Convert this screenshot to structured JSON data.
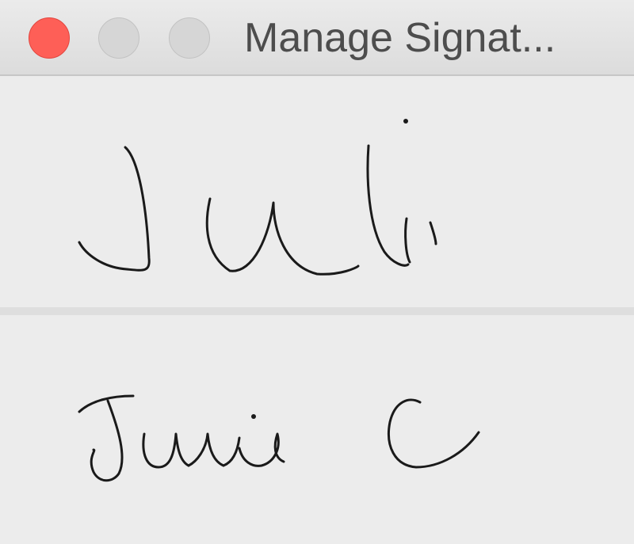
{
  "window": {
    "title": "Manage Signat...",
    "controls": {
      "close_color": "#fe5f57",
      "minimize_color": "#d6d6d6",
      "zoom_color": "#d6d6d6"
    }
  },
  "signatures": [
    {
      "text": "Juli"
    },
    {
      "text": "Julie C"
    }
  ]
}
